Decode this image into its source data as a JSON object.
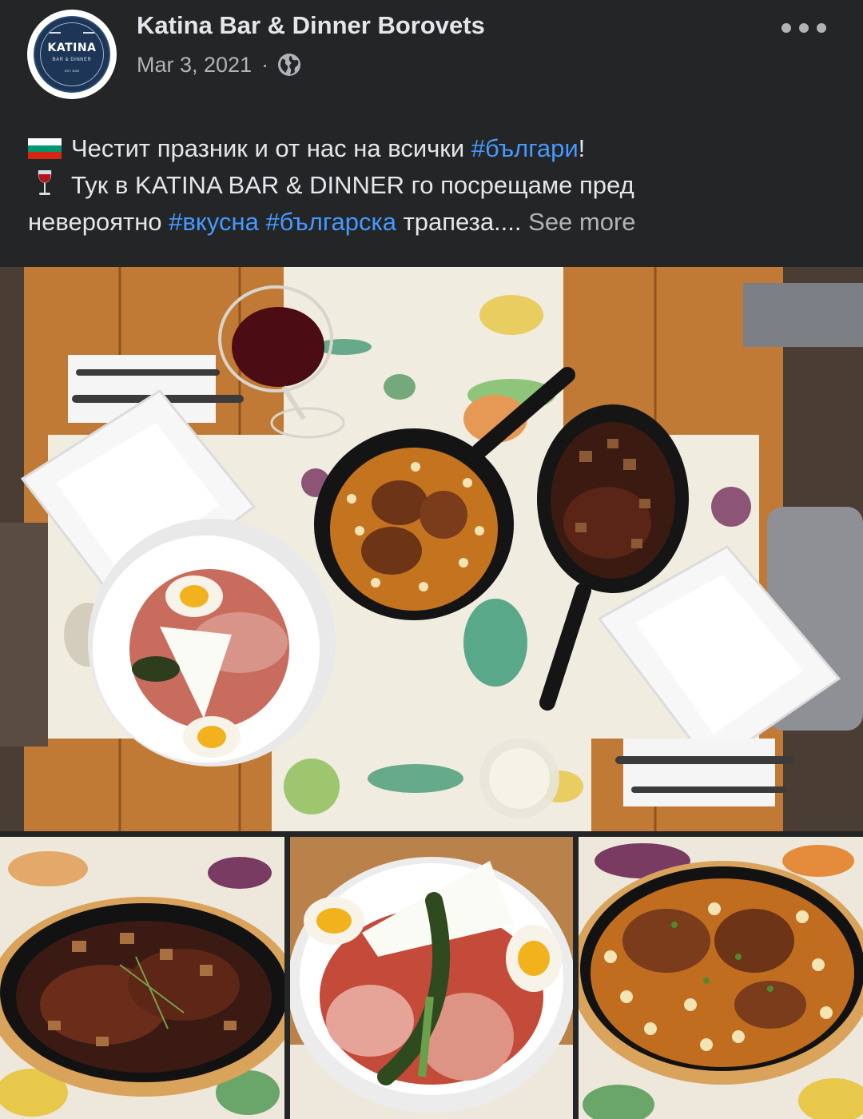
{
  "post": {
    "page_name": "Katina Bar & Dinner Borovets",
    "date": "Mar 3, 2021",
    "separator": "·",
    "privacy_icon": "globe-icon",
    "more_icon": "more-horizontal-icon",
    "avatar": {
      "logo_main": "KATINA",
      "logo_sub": "BAR & DINNER",
      "logo_est": "EST. 2020"
    },
    "text": {
      "line1": {
        "emoji": "bulgaria-flag-emoji",
        "prefix": "Честит празник и от нас на всички ",
        "hashtag": "#българи",
        "suffix": "!"
      },
      "line2": {
        "emoji": "wine-glass-emoji",
        "text": "Тук в KATINA BAR & DINNER го посрещаме пред"
      },
      "line3": {
        "prefix": "невероятно ",
        "hashtag1": "#вкусна",
        "space": " ",
        "hashtag2": "#българска",
        "suffix": " трапеза.... ",
        "see_more": "See more"
      }
    },
    "photos": [
      {
        "name": "table-spread-photo",
        "description": "overhead table with salad, beans skillet, liver skillet, wine"
      },
      {
        "name": "liver-skillet-photo"
      },
      {
        "name": "shopska-salad-photo"
      },
      {
        "name": "beans-skillet-photo"
      }
    ],
    "colors": {
      "background": "#242526",
      "primary_text": "#e4e6eb",
      "secondary_text": "#b0b3b8",
      "hashtag": "#4599ff"
    }
  }
}
